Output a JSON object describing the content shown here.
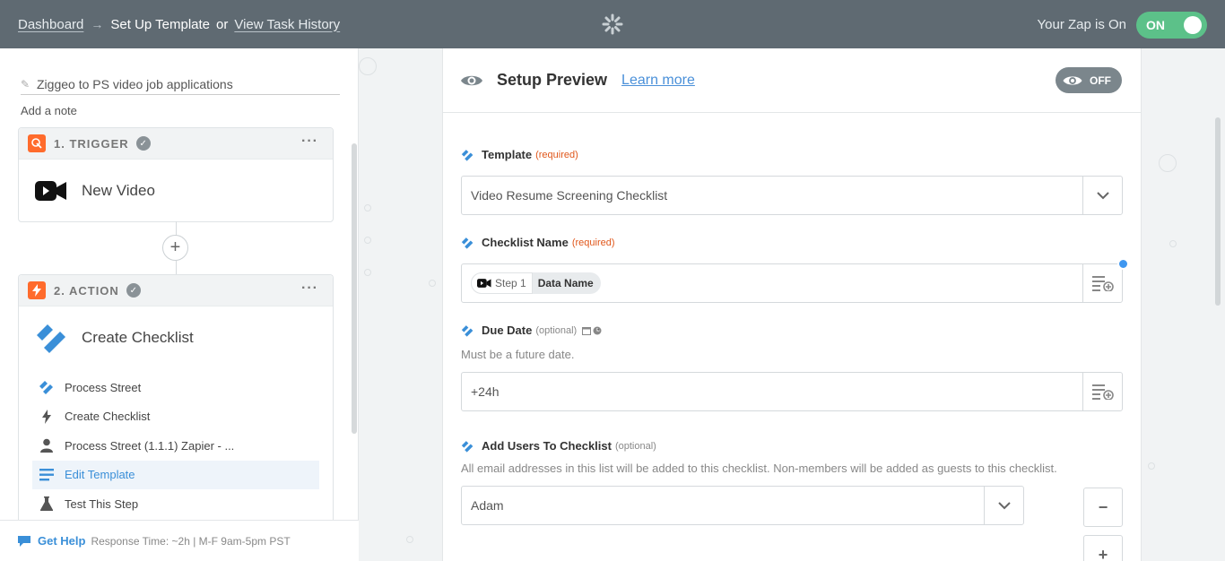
{
  "topbar": {
    "dashboard": "Dashboard",
    "arrow": "→",
    "current": "Set Up Template",
    "or": "or",
    "task_history": "View Task History",
    "zap_status": "Your Zap is On",
    "toggle_label": "ON"
  },
  "left": {
    "zap_name": "Ziggeo to PS video job applications",
    "add_note": "Add a note",
    "trigger": {
      "title": "1. TRIGGER",
      "app": "New Video"
    },
    "action": {
      "title": "2. ACTION",
      "app": "Create Checklist"
    },
    "substeps": [
      {
        "label": "Process Street",
        "icon": "process-street-icon"
      },
      {
        "label": "Create Checklist",
        "icon": "bolt-icon"
      },
      {
        "label": "Process Street (1.1.1) Zapier - ...",
        "icon": "user-icon"
      },
      {
        "label": "Edit Template",
        "icon": "list-icon",
        "active": true
      },
      {
        "label": "Test This Step",
        "icon": "flask-icon"
      }
    ],
    "help": {
      "link": "Get Help",
      "text": "Response Time: ~2h | M-F 9am-5pm PST"
    }
  },
  "right": {
    "title": "Setup Preview",
    "learn_more": "Learn more",
    "off_label": "OFF",
    "fields": {
      "template": {
        "label": "Template",
        "tag": "(required)",
        "value": "Video Resume Screening Checklist"
      },
      "checklist_name": {
        "label": "Checklist Name",
        "tag": "(required)",
        "pill_step": "Step 1",
        "pill_value": "Data Name"
      },
      "due_date": {
        "label": "Due Date",
        "tag": "(optional)",
        "help": "Must be a future date.",
        "value": "+24h"
      },
      "add_users": {
        "label": "Add Users To Checklist",
        "tag": "(optional)",
        "help": "All email addresses in this list will be added to this checklist. Non-members will be added as guests to this checklist.",
        "value": "Adam"
      }
    }
  },
  "colors": {
    "topbar": "#5f6a72",
    "on_toggle": "#5cc189",
    "accent": "#3a8fd8",
    "required": "#e0561a",
    "zapier_orange": "#ff6b2c"
  }
}
